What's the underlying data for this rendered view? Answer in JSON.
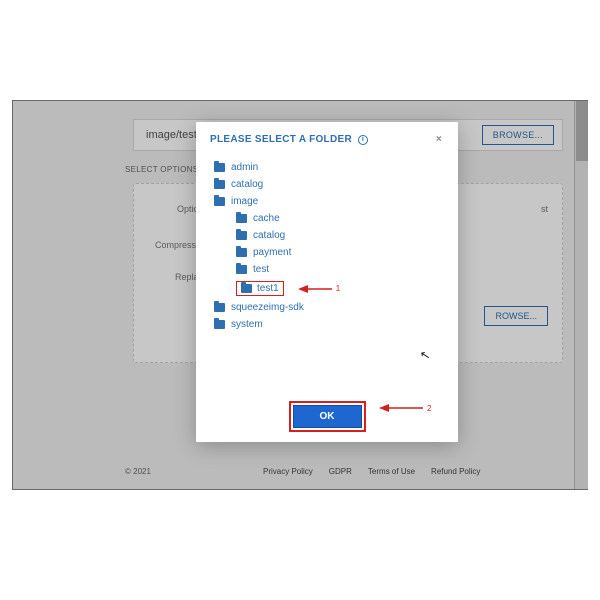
{
  "background": {
    "path_input": "image/test",
    "browse_label": "BROWSE...",
    "select_options_label": "SELECT OPTIONS",
    "option_row1": "Options",
    "option_row2": "Compression",
    "option_right": "st",
    "replace_label": "Replace",
    "browse2_label": "ROWSE...",
    "copyright": "© 2021",
    "footer": {
      "a": "Privacy Policy",
      "b": "GDPR",
      "c": "Terms of Use",
      "d": "Refund Policy"
    }
  },
  "modal": {
    "title": "PLEASE SELECT A FOLDER",
    "close": "×",
    "ok_label": "OK",
    "callout1": "1",
    "callout2": "2",
    "tree": {
      "admin": "admin",
      "catalog": "catalog",
      "image": "image",
      "image_children": {
        "cache": "cache",
        "catalog": "catalog",
        "payment": "payment",
        "test": "test",
        "test1": "test1"
      },
      "squeezeimg": "squeezeimg-sdk",
      "system": "system"
    }
  }
}
